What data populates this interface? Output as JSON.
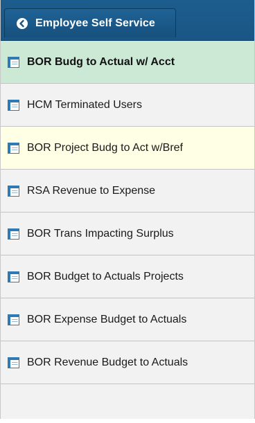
{
  "header": {
    "back_label": "Employee Self Service"
  },
  "items": [
    {
      "label": "BOR Budg to Actual w/ Acct",
      "state": "selected"
    },
    {
      "label": "HCM Terminated Users",
      "state": "normal"
    },
    {
      "label": "BOR Project Budg to Act w/Bref",
      "state": "hover"
    },
    {
      "label": "RSA Revenue to Expense",
      "state": "normal"
    },
    {
      "label": "BOR Trans Impacting Surplus",
      "state": "normal"
    },
    {
      "label": "BOR Budget to Actuals Projects",
      "state": "normal"
    },
    {
      "label": "BOR Expense Budget to Actuals",
      "state": "normal"
    },
    {
      "label": "BOR Revenue Budget to Actuals",
      "state": "normal"
    }
  ],
  "colors": {
    "header": "#1a5685",
    "selected": "#cce9d6",
    "hover": "#ffffe6",
    "icon_blue": "#2f79b5"
  }
}
